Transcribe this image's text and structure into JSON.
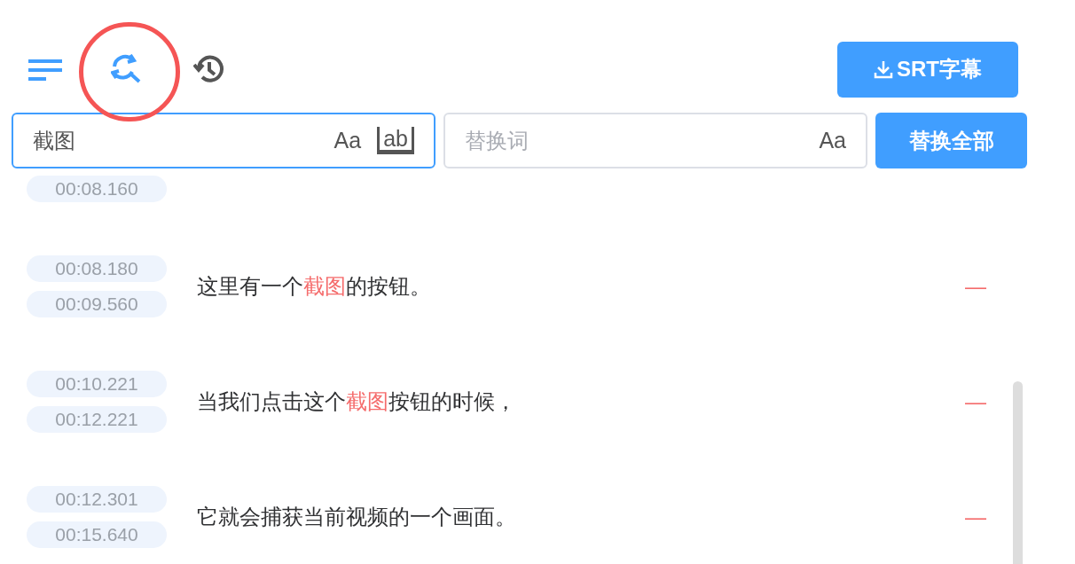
{
  "toolbar": {
    "download_button": "SRT字幕"
  },
  "search": {
    "value": "截图",
    "match_case": "Aa",
    "whole_word": "ab"
  },
  "replace": {
    "placeholder": "替换词",
    "match_case": "Aa",
    "button": "替换全部"
  },
  "rows": [
    {
      "end": "00:08.160"
    },
    {
      "start": "00:08.180",
      "end": "00:09.560",
      "segments": [
        {
          "text": "这里有一个",
          "match": false
        },
        {
          "text": "截图",
          "match": true
        },
        {
          "text": "的按钮。",
          "match": false
        }
      ],
      "delete": "—"
    },
    {
      "start": "00:10.221",
      "end": "00:12.221",
      "segments": [
        {
          "text": "当我们点击这个",
          "match": false
        },
        {
          "text": "截图",
          "match": true
        },
        {
          "text": "按钮的时候，",
          "match": false
        }
      ],
      "delete": "—"
    },
    {
      "start": "00:12.301",
      "end": "00:15.640",
      "segments": [
        {
          "text": "它就会捕获当前视频的一个画面。",
          "match": false
        }
      ],
      "delete": "—"
    }
  ]
}
